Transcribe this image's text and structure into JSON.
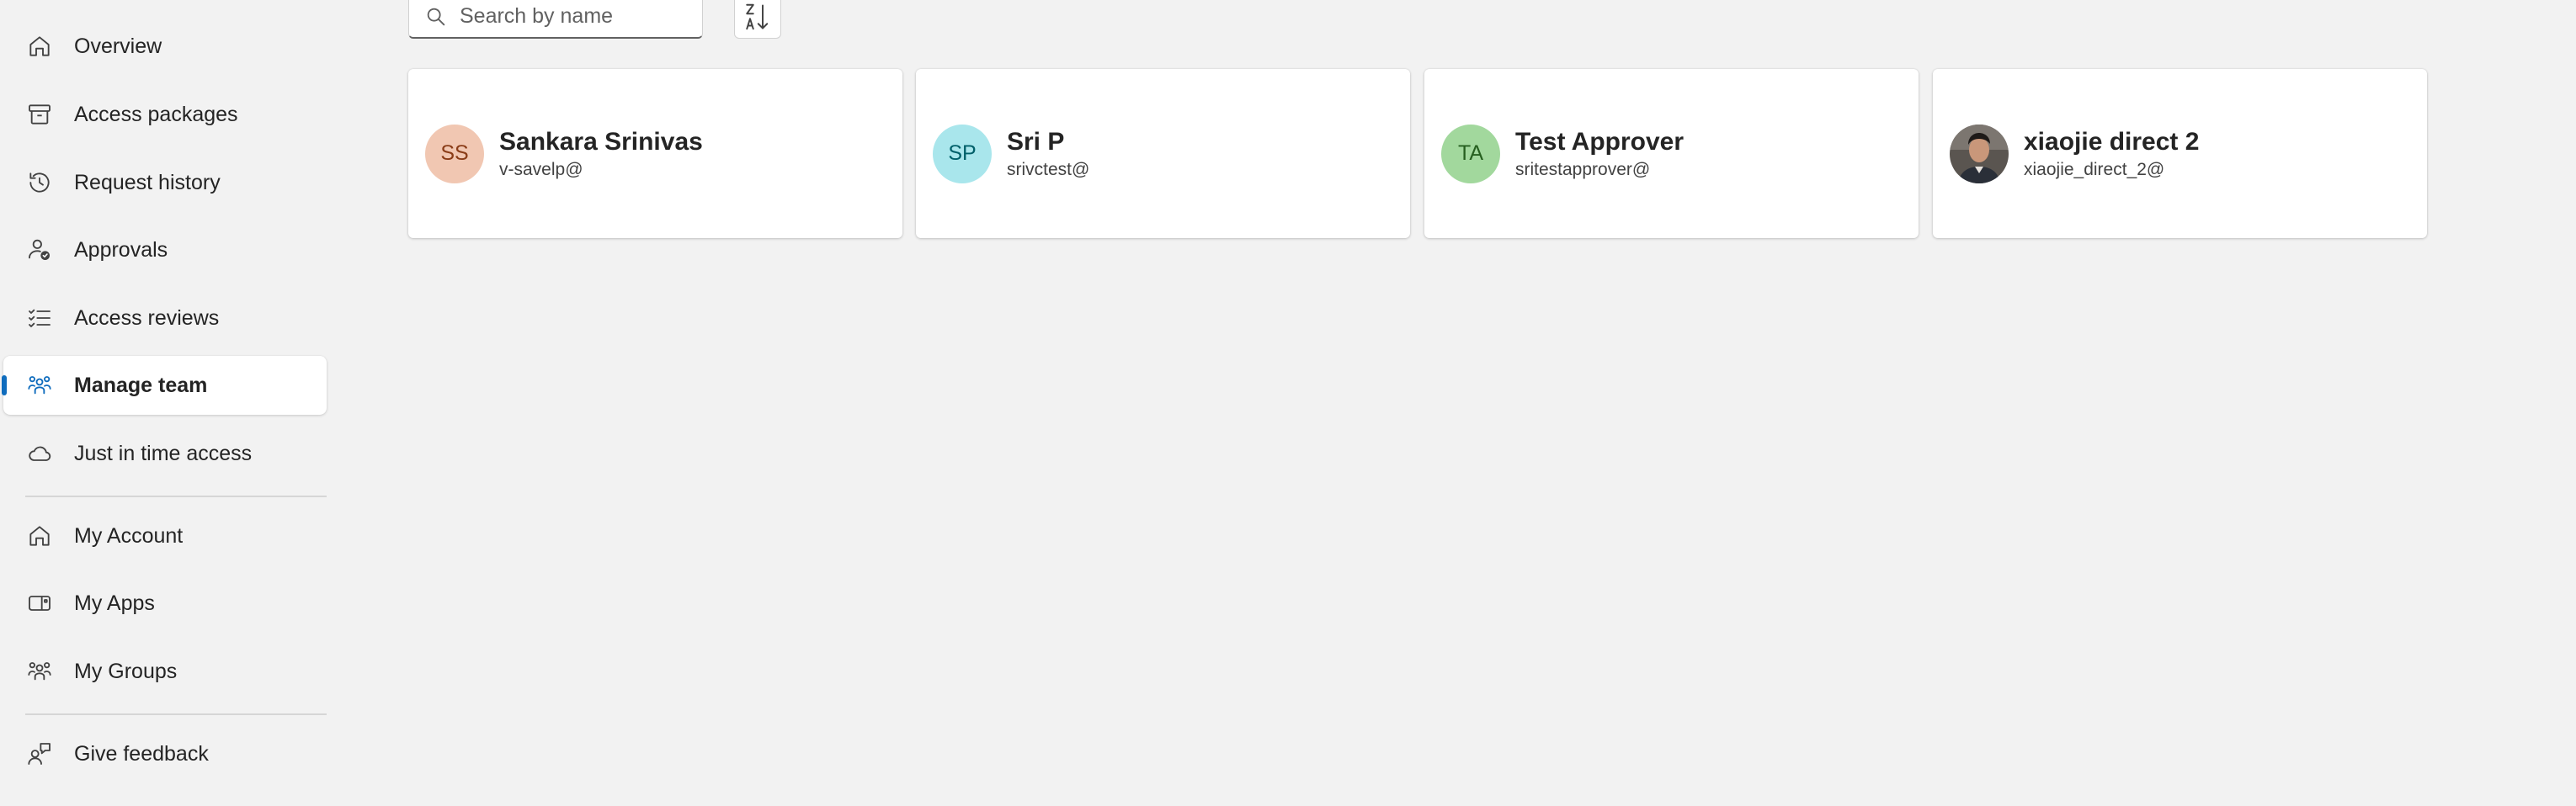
{
  "sidebar": {
    "items": [
      {
        "label": "Overview",
        "icon": "home-icon"
      },
      {
        "label": "Access packages",
        "icon": "archive-icon"
      },
      {
        "label": "Request history",
        "icon": "history-icon"
      },
      {
        "label": "Approvals",
        "icon": "approvals-icon"
      },
      {
        "label": "Access reviews",
        "icon": "checklist-icon"
      },
      {
        "label": "Manage team",
        "icon": "people-team-icon",
        "active": true
      },
      {
        "label": "Just in time access",
        "icon": "cloud-icon"
      }
    ],
    "secondary_items": [
      {
        "label": "My Account",
        "icon": "home-icon"
      },
      {
        "label": "My Apps",
        "icon": "apps-icon"
      },
      {
        "label": "My Groups",
        "icon": "people-team-icon"
      }
    ],
    "footer_items": [
      {
        "label": "Give feedback",
        "icon": "person-feedback-icon"
      }
    ]
  },
  "toolbar": {
    "search_placeholder": "Search by name",
    "search_value": "",
    "sort_icon": "sort-z-to-a-icon"
  },
  "members": [
    {
      "initials": "SS",
      "name": "Sankara Srinivas",
      "email": "v-savelp@",
      "avatar_bg": "#f1c7b2",
      "avatar_fg": "#8a3c17"
    },
    {
      "initials": "SP",
      "name": "Sri P",
      "email": "srivctest@",
      "avatar_bg": "#a9e6ec",
      "avatar_fg": "#00606a"
    },
    {
      "initials": "TA",
      "name": "Test Approver",
      "email": "sritestapprover@",
      "avatar_bg": "#a2d89d",
      "avatar_fg": "#265f1f"
    },
    {
      "initials": "",
      "name": "xiaojie direct 2",
      "email": "xiaojie_direct_2@",
      "avatar_photo": true
    }
  ],
  "colors": {
    "accent": "#0f6cbd",
    "page_bg": "#f2f2f2",
    "card_bg": "#ffffff"
  }
}
